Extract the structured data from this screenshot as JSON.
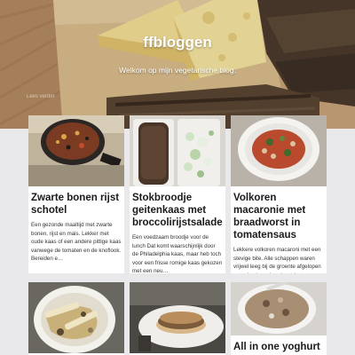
{
  "site": {
    "title": "ffbloggen",
    "tagline": "Welkom op mijn vegetarische blog.",
    "faded_link": "Lees verder"
  },
  "posts": [
    {
      "title": "Zwarte bonen rijst schotel",
      "excerpt": "Een gezonde maaltijd met zwarte bonen, rijst en mais. Lekker met oude kaas of een andere pittige kaas vanwege de tomaten en de knoflook. Bereiden e…",
      "thumb": "black-bean-rice-pan"
    },
    {
      "title": "Stokbroodje geitenkaas met broccolirijstsalade",
      "excerpt": "Een voedzaam broodje voor de lunch Dat komt waarschijnlijk door de Philadelphia kaas, maar heb toch voor een frisse romige kaas gekozen met een neu…",
      "thumb": "baguette-and-broccoli-salad"
    },
    {
      "title": "Volkoren macaronie met braadworst in tomatensaus",
      "excerpt": "Lekkere volkoren macaroni met een stevige bite. Alle schappen waren vrijwel leeg bij de groente afgelopen zaterdag in verband met het corona virus....",
      "thumb": "macaroni-plate"
    },
    {
      "title": "",
      "excerpt": "",
      "thumb": "pasta-plate"
    },
    {
      "title": "",
      "excerpt": "",
      "thumb": "sandwich-plate"
    },
    {
      "title": "All in one yoghurt",
      "excerpt": "",
      "thumb": "yoghurt-bowl"
    }
  ]
}
